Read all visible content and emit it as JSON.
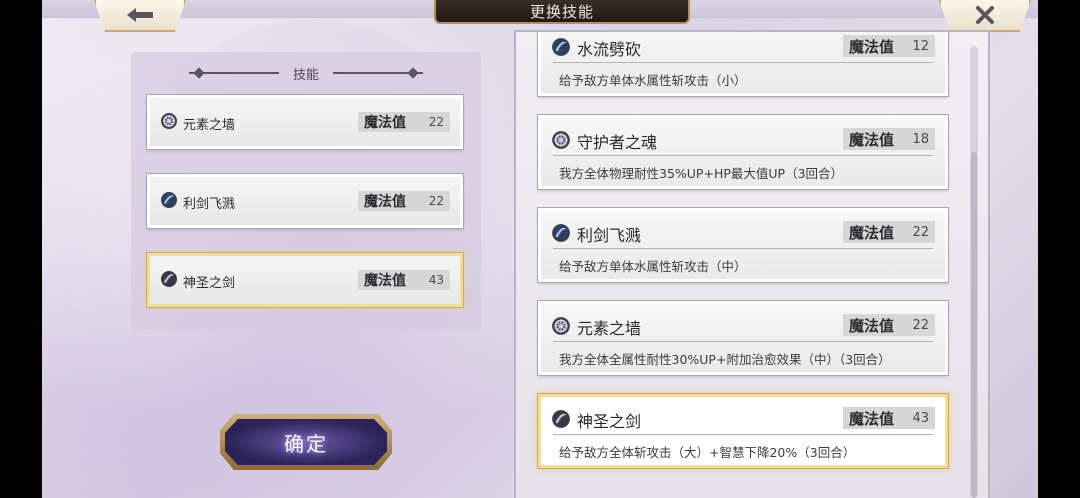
{
  "header": {
    "title": "更换技能"
  },
  "icons": {
    "back": "back-arrow-icon",
    "close": "close-x-icon",
    "element": "element-ring-icon",
    "water": "water-orb-icon",
    "sword": "sword-orb-icon"
  },
  "colors": {
    "accent_gold": "#c7a86a",
    "confirm_purple": "#2c2358",
    "selected_border": "#f2dc9a"
  },
  "equipped": {
    "title": "技能",
    "mp_label": "魔法值",
    "slots": [
      {
        "name": "元素之墙",
        "mp": "22",
        "icon": "element-ring-icon",
        "selected": false
      },
      {
        "name": "利剑飞溅",
        "mp": "22",
        "icon": "water-orb-icon",
        "selected": false
      },
      {
        "name": "神圣之剑",
        "mp": "43",
        "icon": "sword-orb-icon",
        "selected": true
      }
    ]
  },
  "confirm": {
    "label": "确定"
  },
  "skill_list": {
    "mp_label": "魔法值",
    "items": [
      {
        "name": "水流劈砍",
        "mp": "12",
        "desc": "给予敌方单体水属性斩攻击（小）",
        "icon": "water-orb-icon"
      },
      {
        "name": "守护者之魂",
        "mp": "18",
        "desc": "我方全体物理耐性35%UP+HP最大值UP（3回合）",
        "icon": "element-ring-icon"
      },
      {
        "name": "利剑飞溅",
        "mp": "22",
        "desc": "给予敌方单体水属性斩攻击（中）",
        "icon": "water-orb-icon"
      },
      {
        "name": "元素之墙",
        "mp": "22",
        "desc": "我方全体全属性耐性30%UP+附加治愈效果（中）（3回合）",
        "icon": "element-ring-icon"
      },
      {
        "name": "神圣之剑",
        "mp": "43",
        "desc": "给予敌方全体斩攻击（大）+智慧下降20%（3回合）",
        "icon": "sword-orb-icon",
        "selected": true
      }
    ]
  }
}
